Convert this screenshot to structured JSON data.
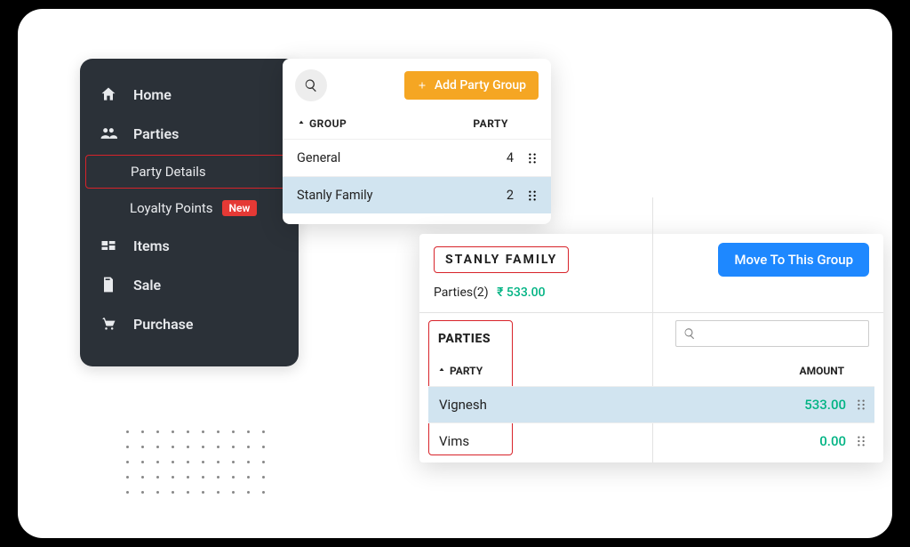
{
  "sidebar": {
    "items": [
      {
        "label": "Home"
      },
      {
        "label": "Parties"
      },
      {
        "label": "Items"
      },
      {
        "label": "Sale"
      },
      {
        "label": "Purchase"
      }
    ],
    "sub": [
      {
        "label": "Party Details"
      },
      {
        "label": "Loyalty Points",
        "badge": "New"
      }
    ]
  },
  "groups_panel": {
    "add_button": "Add Party Group",
    "col_group": "GROUP",
    "col_party": "PARTY",
    "rows": [
      {
        "name": "General",
        "count": "4"
      },
      {
        "name": "Stanly Family",
        "count": "2"
      }
    ]
  },
  "parties_panel": {
    "group_title": "STANLY FAMILY",
    "move_button": "Move To This Group",
    "summary_label": "Parties(2)",
    "summary_amount": "₹ 533.00",
    "section_title": "PARTIES",
    "col_party": "PARTY",
    "col_amount": "AMOUNT",
    "rows": [
      {
        "name": "Vignesh",
        "amount": "533.00"
      },
      {
        "name": "Vims",
        "amount": "0.00"
      }
    ]
  }
}
